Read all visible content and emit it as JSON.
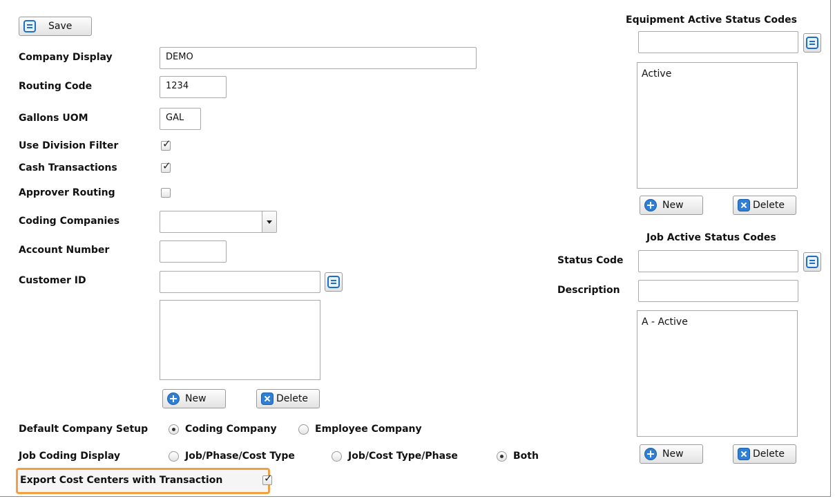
{
  "toolbar": {
    "save_label": "Save"
  },
  "form": {
    "company_display": {
      "label": "Company Display",
      "value": "DEMO"
    },
    "routing_code": {
      "label": "Routing Code",
      "value": "1234"
    },
    "gallons_uom": {
      "label": "Gallons UOM",
      "value": "GAL"
    },
    "use_division_filter": {
      "label": "Use Division Filter",
      "checked": true
    },
    "cash_transactions": {
      "label": "Cash Transactions",
      "checked": true
    },
    "approver_routing": {
      "label": "Approver Routing",
      "checked": false
    },
    "coding_companies": {
      "label": "Coding Companies",
      "value": ""
    },
    "account_number": {
      "label": "Account Number",
      "value": ""
    },
    "customer_id": {
      "label": "Customer ID",
      "value": "",
      "list": []
    },
    "new_label": "New",
    "delete_label": "Delete",
    "default_company_setup": {
      "label": "Default Company Setup",
      "options": [
        "Coding Company",
        "Employee Company"
      ],
      "selected": "Coding Company"
    },
    "job_coding_display": {
      "label": "Job Coding Display",
      "options": [
        "Job/Phase/Cost Type",
        "Job/Cost Type/Phase",
        "Both"
      ],
      "selected": "Both"
    },
    "export_cost_centers": {
      "label": "Export Cost Centers with Transaction",
      "checked": true
    }
  },
  "equipment_status": {
    "title": "Equipment Active Status Codes",
    "input_value": "",
    "items": [
      "Active"
    ],
    "new_label": "New",
    "delete_label": "Delete"
  },
  "job_status": {
    "title": "Job Active Status Codes",
    "status_code_label": "Status Code",
    "status_code_value": "",
    "description_label": "Description",
    "description_value": "",
    "items": [
      "A - Active"
    ],
    "new_label": "New",
    "delete_label": "Delete"
  },
  "colors": {
    "accent": "#2f7fd6",
    "highlight": "#f0a040"
  },
  "icons": [
    "save-icon",
    "plus-icon",
    "delete-x-icon",
    "lookup-icon",
    "chevron-down-icon",
    "check-icon"
  ]
}
